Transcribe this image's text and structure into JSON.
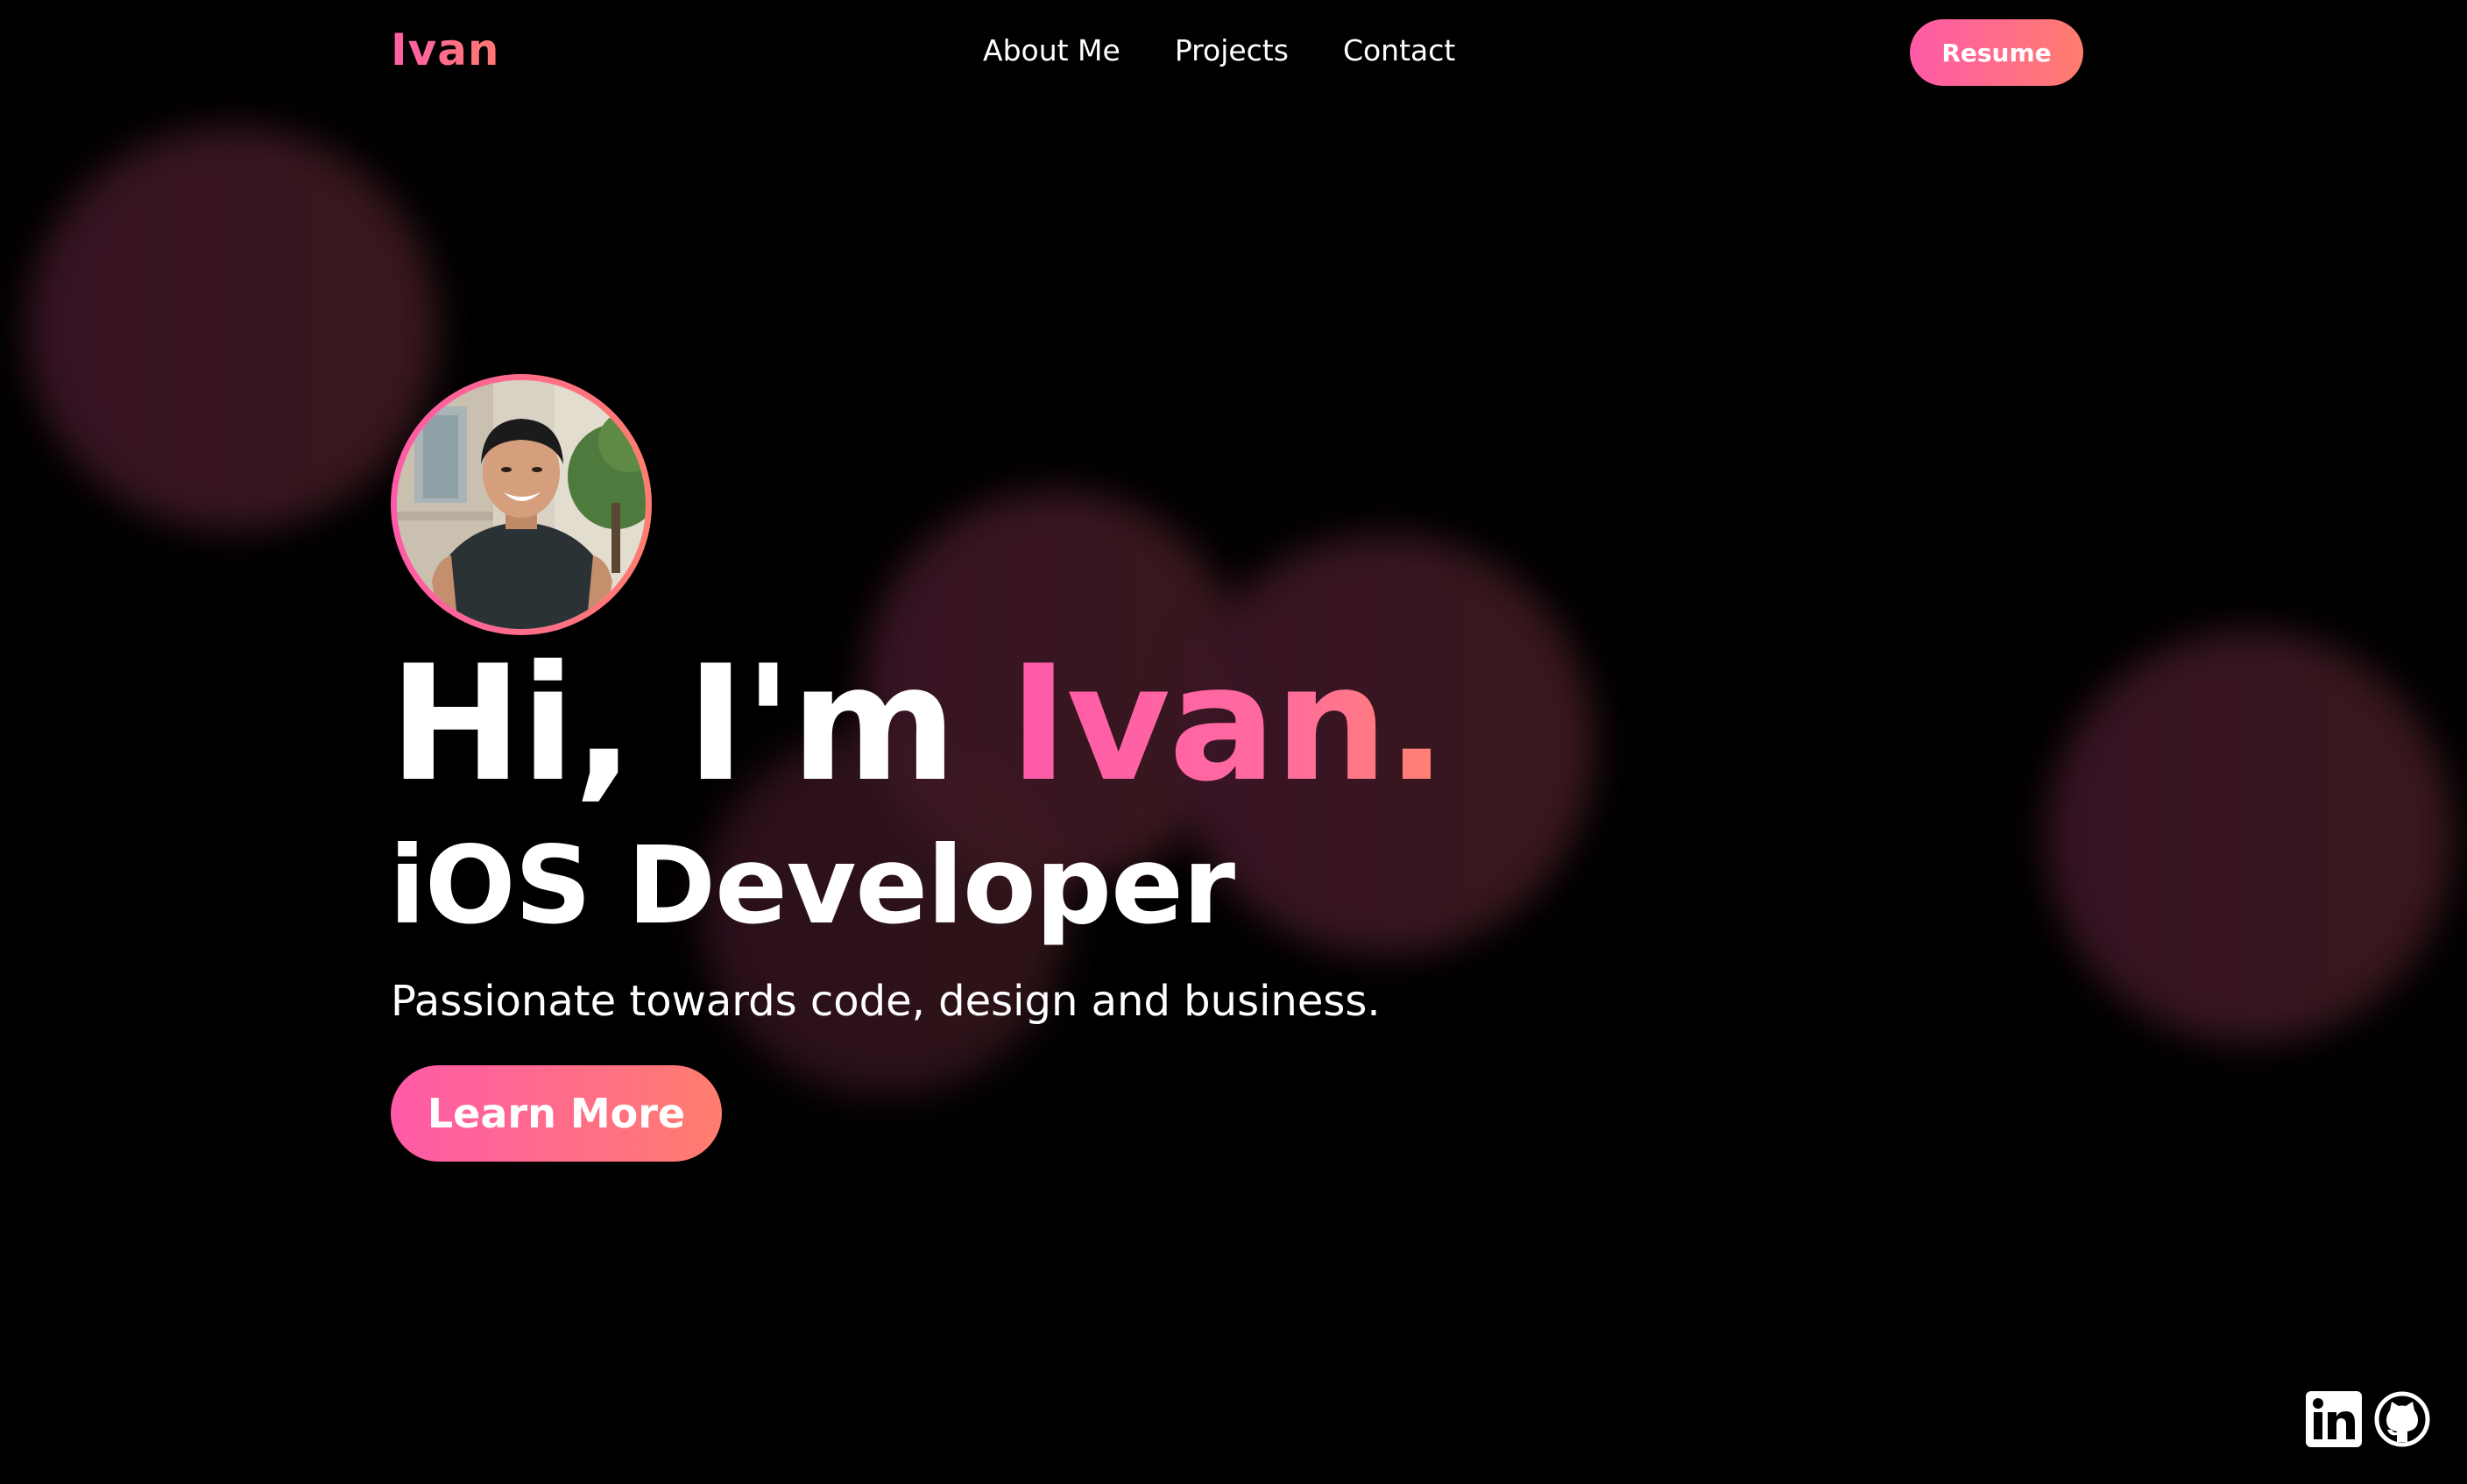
{
  "nav": {
    "brand": "Ivan",
    "links": [
      "About Me",
      "Projects",
      "Contact"
    ],
    "resume_label": "Resume"
  },
  "hero": {
    "greeting": "Hi, I'm ",
    "name": "Ivan.",
    "role": "iOS Developer",
    "tagline": "Passionate towards code, design and business.",
    "cta_label": "Learn More"
  },
  "social": {
    "icons": [
      "linkedin-icon",
      "github-icon"
    ]
  },
  "colors": {
    "accent_start": "#ff5aa8",
    "accent_end": "#ff7d6e",
    "background": "#000000",
    "text": "#ffffff"
  }
}
